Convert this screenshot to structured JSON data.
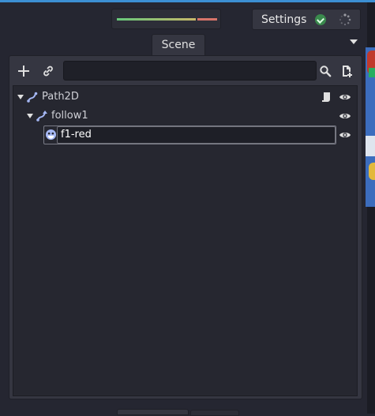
{
  "toolbar": {
    "settings_label": "Settings",
    "status_icon": "check-icon",
    "activity_icon": "spinner-icon"
  },
  "dock": {
    "tab_label": "Scene"
  },
  "scene_tools": {
    "add_icon": "plus-icon",
    "link_icon": "link-icon",
    "filter_placeholder": "",
    "search_icon": "search-icon",
    "attach_script_icon": "script-add-icon"
  },
  "tree": {
    "nodes": [
      {
        "label": "Path2D",
        "icon": "path2d-icon",
        "expanded": true
      },
      {
        "label": "follow1",
        "icon": "pathfollow2d-icon",
        "expanded": true
      },
      {
        "label": "f1-red",
        "icon": "sprite-icon",
        "editing": true
      }
    ]
  },
  "colors": {
    "accent": "#3c8fd3",
    "panel": "#353641",
    "tree_bg": "#262730",
    "node_icon": "#a5b7f3",
    "ok": "#3a8a4d"
  }
}
